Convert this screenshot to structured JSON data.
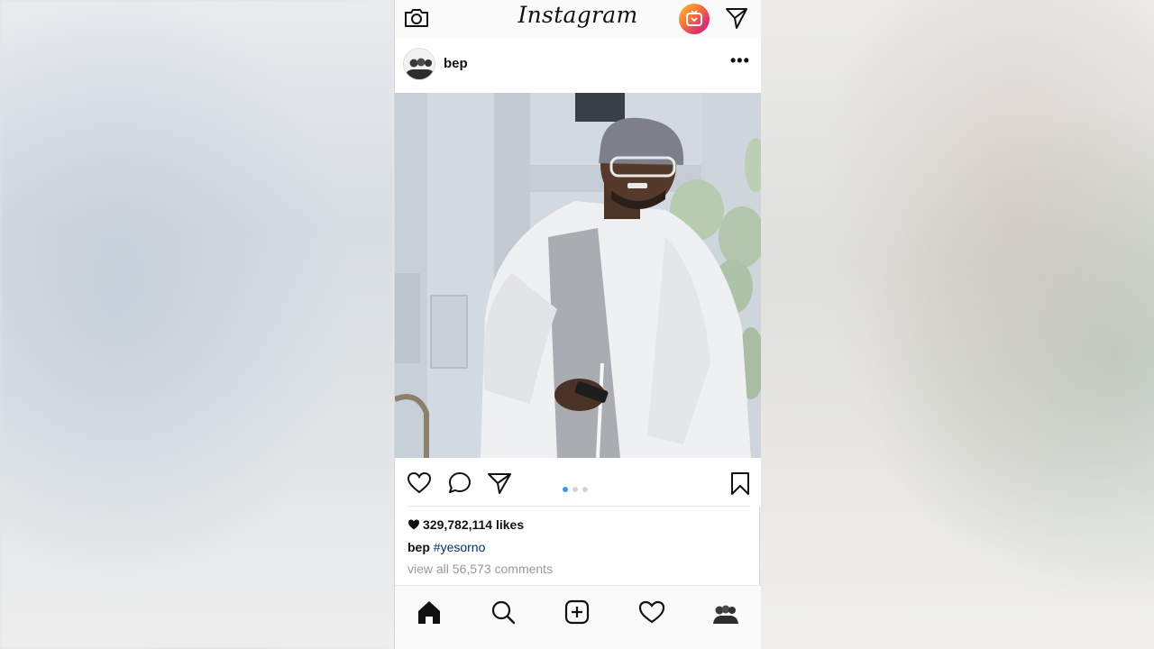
{
  "app": {
    "logo": "Instagram"
  },
  "post": {
    "username": "bep",
    "more_label": "•••",
    "likes": "329,782,114 likes",
    "caption_user": "bep",
    "caption_tag": "#yesorno",
    "comments_link": "view all 56,573 comments",
    "carousel": {
      "count": 3,
      "active_index": 0
    }
  },
  "icons": {
    "top_left": "camera-icon",
    "top_right_1": "igtv-icon",
    "top_right_2": "direct-send-icon",
    "actions": [
      "heart-icon",
      "comment-icon",
      "share-icon",
      "bookmark-icon"
    ],
    "tabs": [
      "home-icon",
      "search-icon",
      "add-post-icon",
      "activity-heart-icon",
      "profile-avatar-icon"
    ]
  },
  "colors": {
    "link_blue": "#003569",
    "carousel_active": "#3897f0",
    "meta_gray": "#999999"
  }
}
